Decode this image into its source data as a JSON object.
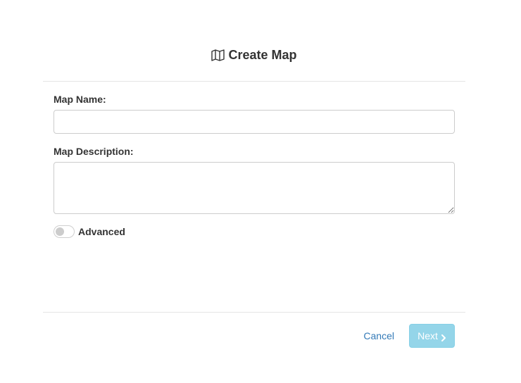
{
  "dialog": {
    "title": "Create Map",
    "title_icon": "map-icon"
  },
  "form": {
    "name_label": "Map Name:",
    "name_value": "",
    "description_label": "Map Description:",
    "description_value": "",
    "advanced_label": "Advanced",
    "advanced_enabled": false
  },
  "footer": {
    "cancel_label": "Cancel",
    "next_label": "Next",
    "next_icon": "chevron-right-icon"
  },
  "colors": {
    "link": "#337ab7",
    "next_button": "#5bc0de",
    "divider": "#e5e5e5"
  }
}
